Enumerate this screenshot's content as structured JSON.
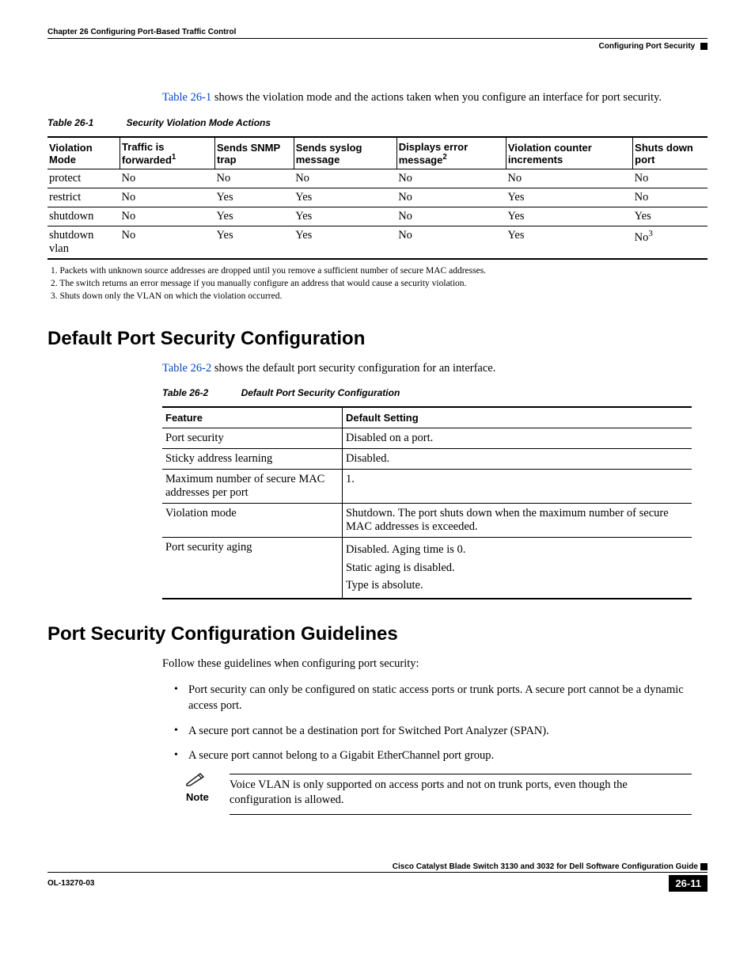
{
  "header": {
    "chapter": "Chapter 26      Configuring Port-Based Traffic Control",
    "section": "Configuring Port Security"
  },
  "intro": {
    "link": "Table 26-1",
    "rest": " shows the violation mode and the actions taken when you configure an interface for port security."
  },
  "table1": {
    "caption_num": "Table 26-1",
    "caption_title": "Security Violation Mode Actions",
    "headers": [
      "Violation Mode",
      "Traffic is forwarded",
      "Sends SNMP trap",
      "Sends syslog message",
      "Displays error message",
      "Violation counter increments",
      "Shuts down port"
    ],
    "sup1": "1",
    "sup2": "2",
    "sup3": "3",
    "rows": [
      [
        "protect",
        "No",
        "No",
        "No",
        "No",
        "No",
        "No"
      ],
      [
        "restrict",
        "No",
        "Yes",
        "Yes",
        "No",
        "Yes",
        "No"
      ],
      [
        "shutdown",
        "No",
        "Yes",
        "Yes",
        "No",
        "Yes",
        "Yes"
      ],
      [
        "shutdown vlan",
        "No",
        "Yes",
        "Yes",
        "No",
        "Yes",
        "No"
      ]
    ],
    "footnotes": [
      "1.   Packets with unknown source addresses are dropped until you remove a sufficient number of secure MAC addresses.",
      "2.   The switch returns an error message if you manually configure an address that would cause a security violation.",
      "3.   Shuts down only the VLAN on which the violation occurred."
    ]
  },
  "section1": {
    "title": "Default Port Security Configuration",
    "link": "Table 26-2",
    "rest": " shows the default port security configuration for an interface."
  },
  "table2": {
    "caption_num": "Table 26-2",
    "caption_title": "Default Port Security Configuration",
    "h1": "Feature",
    "h2": "Default Setting",
    "rows": [
      {
        "f": "Port security",
        "d": "Disabled on a port."
      },
      {
        "f": "Sticky address learning",
        "d": "Disabled."
      },
      {
        "f": "Maximum number of secure MAC addresses per port",
        "d": "1."
      },
      {
        "f": "Violation mode",
        "d": "Shutdown. The port shuts down when the maximum number of secure MAC addresses is exceeded."
      },
      {
        "f": "Port security aging",
        "d": "Disabled. Aging time is 0.\nStatic aging is disabled.\nType is absolute."
      }
    ]
  },
  "section2": {
    "title": "Port Security Configuration Guidelines",
    "intro": "Follow these guidelines when configuring port security:",
    "bullets": [
      "Port security can only be configured on static access ports or trunk ports. A secure port cannot be a dynamic access port.",
      "A secure port cannot be a destination port for Switched Port Analyzer (SPAN).",
      "A secure port cannot belong to a Gigabit EtherChannel port group."
    ],
    "note_label": "Note",
    "note_text": "Voice VLAN is only supported on access ports and not on trunk ports, even though the configuration is allowed."
  },
  "footer": {
    "guide": "Cisco Catalyst Blade Switch 3130 and 3032 for Dell Software Configuration Guide",
    "left": "OL-13270-03",
    "page": "26-11"
  }
}
